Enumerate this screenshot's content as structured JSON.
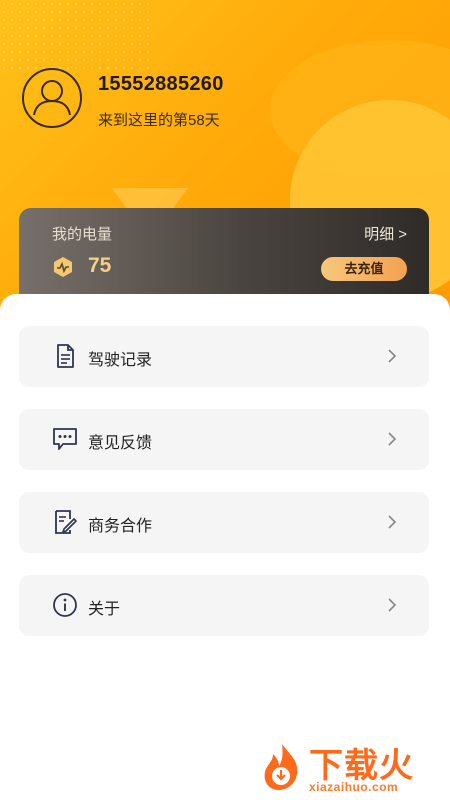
{
  "profile": {
    "phone": "15552885260",
    "days_text": "来到这里的第58天"
  },
  "energy": {
    "title": "我的电量",
    "detail_label": "明细 >",
    "value": "75",
    "recharge_label": "去充值"
  },
  "menu": [
    {
      "label": "驾驶记录",
      "icon": "document-icon"
    },
    {
      "label": "意见反馈",
      "icon": "chat-bubble-icon"
    },
    {
      "label": "商务合作",
      "icon": "edit-document-icon"
    },
    {
      "label": "关于",
      "icon": "info-icon"
    }
  ],
  "watermark": {
    "title": "下载火",
    "subtitle": "xiazaihuo.com"
  },
  "colors": {
    "accent": "#ffab0a",
    "card_dark": "#3a3531",
    "gold_text": "#f4cf86"
  }
}
